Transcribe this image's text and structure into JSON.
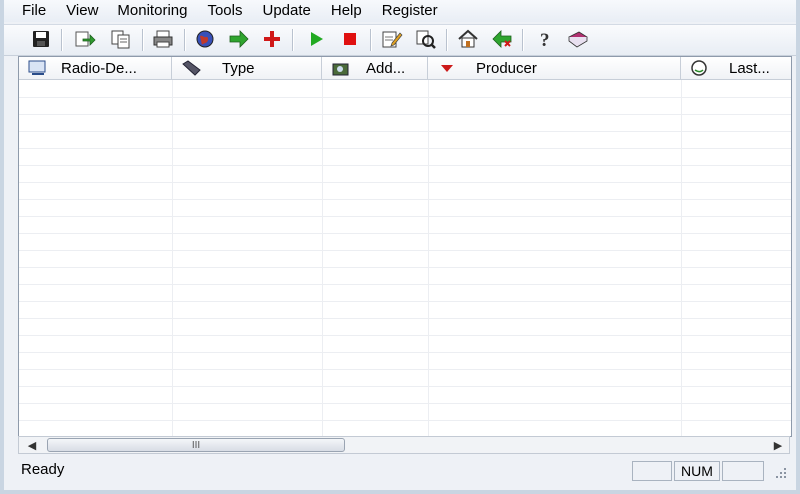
{
  "menu": {
    "items": [
      "File",
      "View",
      "Monitoring",
      "Tools",
      "Update",
      "Help",
      "Register"
    ]
  },
  "toolbar": {
    "icons": [
      "save-icon",
      "export-icon",
      "copy-icon",
      "print-icon",
      "globe-icon",
      "arrow-right-icon",
      "add-icon",
      "play-icon",
      "stop-icon",
      "edit-icon",
      "search-icon",
      "home-icon",
      "back-icon",
      "help-icon",
      "book-icon"
    ]
  },
  "columns": [
    {
      "label": "Radio-De...",
      "icon": "radio-device-icon"
    },
    {
      "label": "Type",
      "icon": "tag-icon"
    },
    {
      "label": "Add...",
      "icon": "address-icon"
    },
    {
      "label": "Producer",
      "icon": "sort-desc-icon"
    },
    {
      "label": "Last...",
      "icon": "last-seen-icon"
    }
  ],
  "scrollbar": {
    "grip": "III"
  },
  "status": {
    "ready": "Ready",
    "panes": [
      "",
      "NUM",
      ""
    ]
  },
  "colors": {
    "accent": "#2f7d2f",
    "stop": "#e01010",
    "add": "#d01818"
  }
}
